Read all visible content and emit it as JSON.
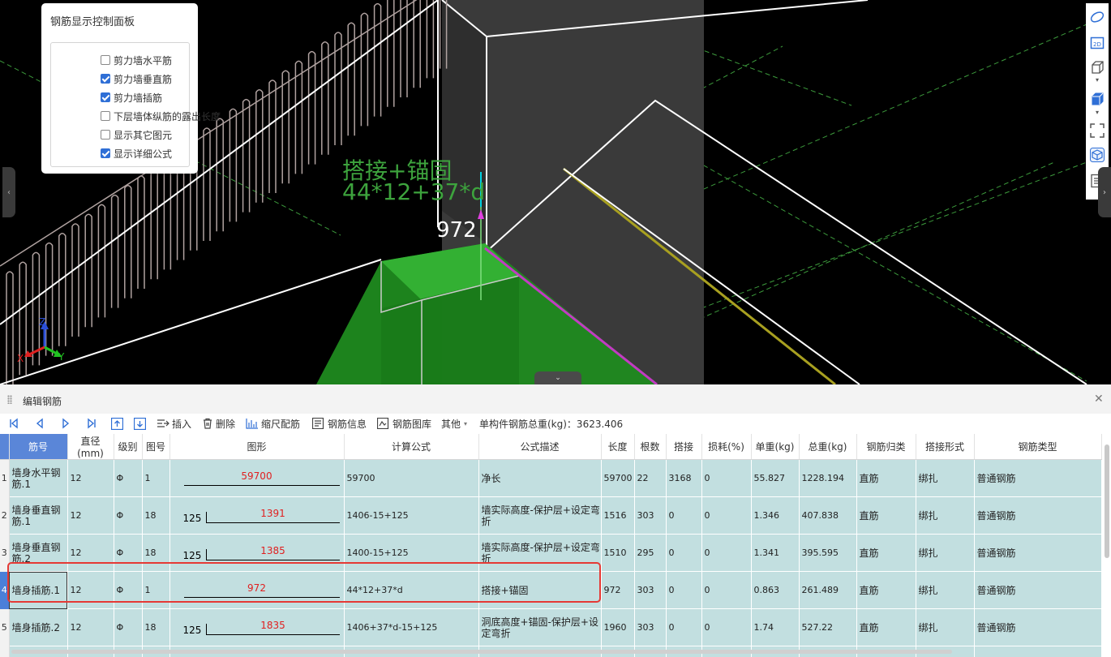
{
  "viewport": {
    "control_panel": {
      "title": "钢筋显示控制面板",
      "options": [
        {
          "label": "剪力墙水平筋",
          "checked": false
        },
        {
          "label": "剪力墙垂直筋",
          "checked": true
        },
        {
          "label": "剪力墙插筋",
          "checked": true
        },
        {
          "label": "下层墙体纵筋的露出长度",
          "checked": false
        },
        {
          "label": "显示其它图元",
          "checked": false
        },
        {
          "label": "显示详细公式",
          "checked": true
        }
      ]
    },
    "scene_labels": {
      "formula_desc": "搭接+锚固",
      "formula": "44*12+37*d",
      "length": "972"
    },
    "axis": {
      "x": "X",
      "y": "Y",
      "z": "Z"
    },
    "side_toolbar": [
      "orbit-icon",
      "2d-view-icon",
      "box-view-icon",
      "solid-box-icon",
      "fit-view-icon",
      "cube-view-icon",
      "list-icon"
    ],
    "colors": {
      "green_text": "#3da33d",
      "accent": "#2f6fd6"
    }
  },
  "editor": {
    "title": "编辑钢筋",
    "toolbar": {
      "insert": "插入",
      "delete": "删除",
      "scale": "缩尺配筋",
      "info": "钢筋信息",
      "library": "钢筋图库",
      "other": "其他",
      "total_weight": "单构件钢筋总重(kg)：3623.406"
    },
    "columns": [
      "筋号",
      "直径(mm)",
      "级别",
      "图号",
      "图形",
      "计算公式",
      "公式描述",
      "长度",
      "根数",
      "搭接",
      "损耗(%)",
      "单重(kg)",
      "总重(kg)",
      "钢筋归类",
      "搭接形式",
      "钢筋类型"
    ],
    "rows": [
      {
        "rn": "1",
        "name": "墙身水平钢筋.1",
        "dia": "12",
        "grade": "Φ",
        "fig": "1",
        "shape_val": "59700",
        "shape_left": "",
        "formula": "59700",
        "desc": "净长",
        "len": "59700",
        "count": "22",
        "lap": "3168",
        "loss": "0",
        "unit_w": "55.827",
        "total_w": "1228.194",
        "cat": "直筋",
        "lap_type": "绑扎",
        "type": "普通钢筋"
      },
      {
        "rn": "2",
        "name": "墙身垂直钢筋.1",
        "dia": "12",
        "grade": "Φ",
        "fig": "18",
        "shape_val": "1391",
        "shape_left": "125",
        "formula": "1406-15+125",
        "desc": "墙实际高度-保护层+设定弯折",
        "len": "1516",
        "count": "303",
        "lap": "0",
        "loss": "0",
        "unit_w": "1.346",
        "total_w": "407.838",
        "cat": "直筋",
        "lap_type": "绑扎",
        "type": "普通钢筋"
      },
      {
        "rn": "3",
        "name": "墙身垂直钢筋.2",
        "dia": "12",
        "grade": "Φ",
        "fig": "18",
        "shape_val": "1385",
        "shape_left": "125",
        "formula": "1400-15+125",
        "desc": "墙实际高度-保护层+设定弯折",
        "len": "1510",
        "count": "295",
        "lap": "0",
        "loss": "0",
        "unit_w": "1.341",
        "total_w": "395.595",
        "cat": "直筋",
        "lap_type": "绑扎",
        "type": "普通钢筋"
      },
      {
        "rn": "4",
        "name": "墙身插筋.1",
        "dia": "12",
        "grade": "Φ",
        "fig": "1",
        "shape_val": "972",
        "shape_left": "",
        "formula": "44*12+37*d",
        "desc": "搭接+锚固",
        "len": "972",
        "count": "303",
        "lap": "0",
        "loss": "0",
        "unit_w": "0.863",
        "total_w": "261.489",
        "cat": "直筋",
        "lap_type": "绑扎",
        "type": "普通钢筋"
      },
      {
        "rn": "5",
        "name": "墙身插筋.2",
        "dia": "12",
        "grade": "Φ",
        "fig": "18",
        "shape_val": "1835",
        "shape_left": "125",
        "formula": "1406+37*d-15+125",
        "desc": "洞底高度+锚固-保护层+设定弯折",
        "len": "1960",
        "count": "303",
        "lap": "0",
        "loss": "0",
        "unit_w": "1.74",
        "total_w": "527.22",
        "cat": "直筋",
        "lap_type": "绑扎",
        "type": "普通钢筋"
      },
      {
        "rn": "",
        "name": "",
        "dia": "",
        "grade": "",
        "fig": "",
        "shape_val": "",
        "shape_left": "",
        "formula": "",
        "desc": "洞底高度+锚固-保护层+设",
        "len": "",
        "count": "",
        "lap": "",
        "loss": "",
        "unit_w": "",
        "total_w": "",
        "cat": "",
        "lap_type": "",
        "type": ""
      }
    ],
    "selected_row": 3
  }
}
